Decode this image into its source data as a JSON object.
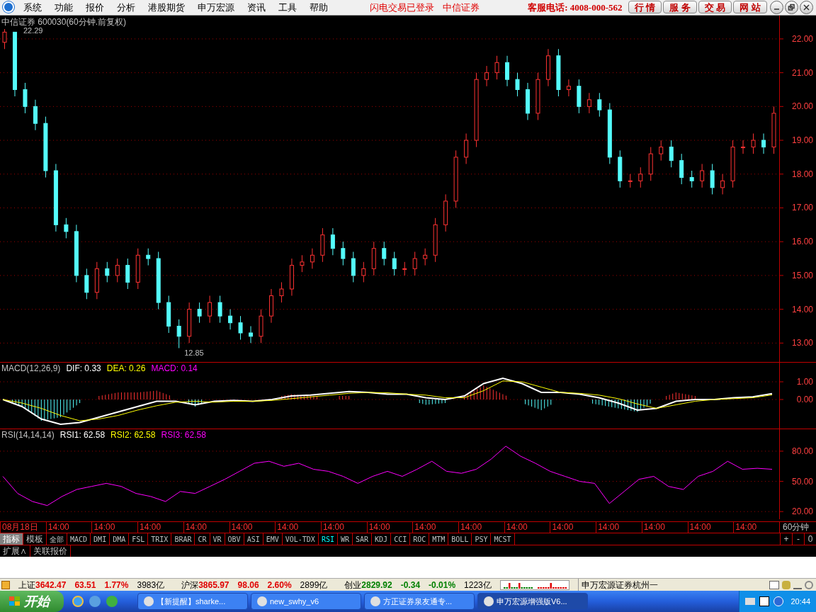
{
  "menu": {
    "items": [
      "系统",
      "功能",
      "报价",
      "分析",
      "港股期货",
      "申万宏源",
      "资讯",
      "工具",
      "帮助"
    ],
    "notices": [
      "闪电交易已登录",
      "中信证券"
    ],
    "hotline": "客服电话: 4008-000-562",
    "buttons": [
      "行 情",
      "服 务",
      "交 易",
      "网 站"
    ]
  },
  "price": {
    "title": "中信证券 600030(60分钟.前复权)",
    "max_label": "22.29",
    "min_label": "12.85",
    "chart_data": {
      "type": "candlestick",
      "ylim": [
        12.42,
        22.69
      ],
      "grid": true,
      "yticks": [
        {
          "value": 22,
          "label": "22.00"
        },
        {
          "value": 21,
          "label": "21.00"
        },
        {
          "value": 20,
          "label": "20.00"
        },
        {
          "value": 19,
          "label": "19.00"
        },
        {
          "value": 18,
          "label": "18.00"
        },
        {
          "value": 17,
          "label": "17.00"
        },
        {
          "value": 16,
          "label": "16.00"
        },
        {
          "value": 15,
          "label": "15.00"
        },
        {
          "value": 14,
          "label": "14.00"
        },
        {
          "value": 13,
          "label": "13.00"
        }
      ],
      "ohlc": [
        [
          21.9,
          22.29,
          21.7,
          22.2
        ],
        [
          22.2,
          22.2,
          20.3,
          20.5
        ],
        [
          20.5,
          20.7,
          19.8,
          20.0
        ],
        [
          20.0,
          20.2,
          19.3,
          19.5
        ],
        [
          19.5,
          19.7,
          17.9,
          18.1
        ],
        [
          18.1,
          18.3,
          16.3,
          16.5
        ],
        [
          16.5,
          16.7,
          16.1,
          16.3
        ],
        [
          16.3,
          16.5,
          14.8,
          15.0
        ],
        [
          15.0,
          15.2,
          14.3,
          14.5
        ],
        [
          14.5,
          15.4,
          14.3,
          15.2
        ],
        [
          15.2,
          15.4,
          14.8,
          15.0
        ],
        [
          15.0,
          15.5,
          14.8,
          15.3
        ],
        [
          15.3,
          15.5,
          14.6,
          14.8
        ],
        [
          14.8,
          15.8,
          14.6,
          15.6
        ],
        [
          15.6,
          15.8,
          15.3,
          15.5
        ],
        [
          15.5,
          15.7,
          14.0,
          14.2
        ],
        [
          14.2,
          14.4,
          13.3,
          13.5
        ],
        [
          13.5,
          13.7,
          12.85,
          13.2
        ],
        [
          13.2,
          14.2,
          13.0,
          14.0
        ],
        [
          14.0,
          14.2,
          13.6,
          13.8
        ],
        [
          13.8,
          14.4,
          13.6,
          14.2
        ],
        [
          14.2,
          14.4,
          13.6,
          13.8
        ],
        [
          13.8,
          14.0,
          13.4,
          13.6
        ],
        [
          13.6,
          13.8,
          13.1,
          13.3
        ],
        [
          13.3,
          13.5,
          13.0,
          13.2
        ],
        [
          13.2,
          14.0,
          13.0,
          13.8
        ],
        [
          13.8,
          14.6,
          13.6,
          14.4
        ],
        [
          14.4,
          14.8,
          14.2,
          14.6
        ],
        [
          14.6,
          15.5,
          14.4,
          15.3
        ],
        [
          15.3,
          15.6,
          15.1,
          15.4
        ],
        [
          15.4,
          15.8,
          15.2,
          15.6
        ],
        [
          15.6,
          16.4,
          15.4,
          16.2
        ],
        [
          16.2,
          16.4,
          15.6,
          15.8
        ],
        [
          15.8,
          16.0,
          15.3,
          15.5
        ],
        [
          15.5,
          15.7,
          14.8,
          15.0
        ],
        [
          15.0,
          15.4,
          14.8,
          15.2
        ],
        [
          15.2,
          16.0,
          15.0,
          15.8
        ],
        [
          15.8,
          16.0,
          15.3,
          15.5
        ],
        [
          15.5,
          15.7,
          15.0,
          15.2
        ],
        [
          15.2,
          15.4,
          15.0,
          15.2
        ],
        [
          15.2,
          15.7,
          15.0,
          15.5
        ],
        [
          15.5,
          15.8,
          15.3,
          15.6
        ],
        [
          15.6,
          16.7,
          15.4,
          16.5
        ],
        [
          16.5,
          17.4,
          16.3,
          17.2
        ],
        [
          17.2,
          18.7,
          17.0,
          18.5
        ],
        [
          18.5,
          19.2,
          18.3,
          19.0
        ],
        [
          19.0,
          21.0,
          18.8,
          20.8
        ],
        [
          20.8,
          21.2,
          20.6,
          21.0
        ],
        [
          21.0,
          21.5,
          20.8,
          21.3
        ],
        [
          21.3,
          21.5,
          20.6,
          20.8
        ],
        [
          20.8,
          21.0,
          20.3,
          20.5
        ],
        [
          20.5,
          20.7,
          19.6,
          19.8
        ],
        [
          19.8,
          21.0,
          19.6,
          20.8
        ],
        [
          20.8,
          21.7,
          20.6,
          21.5
        ],
        [
          21.5,
          21.7,
          20.3,
          20.5
        ],
        [
          20.5,
          20.8,
          20.3,
          20.6
        ],
        [
          20.6,
          20.8,
          19.8,
          20.0
        ],
        [
          20.0,
          20.4,
          19.8,
          20.2
        ],
        [
          20.2,
          20.4,
          19.7,
          19.9
        ],
        [
          19.9,
          20.1,
          18.3,
          18.5
        ],
        [
          18.5,
          18.7,
          17.6,
          17.8
        ],
        [
          17.8,
          18.0,
          17.6,
          17.8
        ],
        [
          17.8,
          18.2,
          17.6,
          18.0
        ],
        [
          18.0,
          18.8,
          17.8,
          18.6
        ],
        [
          18.6,
          19.0,
          18.4,
          18.8
        ],
        [
          18.8,
          19.0,
          18.2,
          18.4
        ],
        [
          18.4,
          18.6,
          17.7,
          17.9
        ],
        [
          17.9,
          18.1,
          17.6,
          17.8
        ],
        [
          17.8,
          18.3,
          17.6,
          18.1
        ],
        [
          18.1,
          18.3,
          17.4,
          17.6
        ],
        [
          17.6,
          18.0,
          17.4,
          17.8
        ],
        [
          17.8,
          19.0,
          17.6,
          18.8
        ],
        [
          18.8,
          19.0,
          18.6,
          18.8
        ],
        [
          18.8,
          19.2,
          18.6,
          19.0
        ],
        [
          19.0,
          19.2,
          18.6,
          18.8
        ],
        [
          18.8,
          20.0,
          18.6,
          19.8
        ]
      ]
    }
  },
  "macd": {
    "label": "MACD(12,26,9)",
    "readings": [
      {
        "text": "DIF: 0.33",
        "color": "#ffffff"
      },
      {
        "text": "DEA: 0.26",
        "color": "#ffff00"
      },
      {
        "text": "MACD: 0.14",
        "color": "#ff00ff"
      }
    ],
    "chart_data": {
      "type": "line",
      "ylim": [
        -1.68,
        2.08
      ],
      "grid": true,
      "yticks": [
        {
          "value": 1,
          "label": "1.00"
        },
        {
          "value": 0,
          "label": "0.00"
        }
      ],
      "series": [
        {
          "color": "#ffffff",
          "values": [
            0.0,
            -0.4,
            -1.1,
            -1.4,
            -1.3,
            -1.0,
            -0.7,
            -0.4,
            -0.1,
            -0.1,
            -0.3,
            -0.1,
            -0.05,
            -0.1,
            0.0,
            0.2,
            0.25,
            0.35,
            0.45,
            0.4,
            0.3,
            0.3,
            0.1,
            0.0,
            0.2,
            0.9,
            1.2,
            0.9,
            0.4,
            0.4,
            0.3,
            0.1,
            -0.2,
            -0.6,
            -0.5,
            -0.1,
            0.0,
            0.0,
            0.1,
            0.15,
            0.33
          ]
        },
        {
          "color": "#ffff00",
          "values": [
            0.0,
            -0.2,
            -0.5,
            -0.9,
            -1.2,
            -1.1,
            -0.9,
            -0.6,
            -0.35,
            -0.15,
            -0.1,
            -0.15,
            -0.1,
            -0.1,
            -0.05,
            0.05,
            0.15,
            0.25,
            0.35,
            0.4,
            0.38,
            0.3,
            0.25,
            0.1,
            0.1,
            0.5,
            1.05,
            1.0,
            0.7,
            0.4,
            0.35,
            0.25,
            0.05,
            -0.25,
            -0.5,
            -0.3,
            -0.1,
            0.0,
            0.05,
            0.1,
            0.26
          ]
        }
      ]
    }
  },
  "rsi": {
    "label": "RSI(14,14,14)",
    "readings": [
      {
        "text": "RSI1: 62.58",
        "color": "#ffffff"
      },
      {
        "text": "RSI2: 62.58",
        "color": "#ffff00"
      },
      {
        "text": "RSI3: 62.58",
        "color": "#ff00ff"
      }
    ],
    "chart_data": {
      "type": "line",
      "ylim": [
        12.4,
        101.8
      ],
      "grid": true,
      "yticks": [
        {
          "value": 80,
          "label": "80.00"
        },
        {
          "value": 50,
          "label": "50.00"
        },
        {
          "value": 20,
          "label": "20.00"
        }
      ],
      "series": [
        {
          "color": "#ff00ff",
          "values": [
            55,
            38,
            30,
            26,
            35,
            42,
            45,
            48,
            45,
            38,
            35,
            30,
            40,
            38,
            45,
            52,
            60,
            68,
            70,
            65,
            68,
            62,
            60,
            55,
            48,
            55,
            60,
            55,
            62,
            70,
            60,
            58,
            62,
            72,
            85,
            75,
            68,
            60,
            55,
            50,
            48,
            28,
            40,
            52,
            55,
            45,
            42,
            55,
            60,
            70,
            62,
            63,
            62
          ]
        }
      ]
    }
  },
  "time_axis": {
    "labels": [
      "08月18日",
      "14:00",
      "14:00",
      "14:00",
      "14:00",
      "14:00",
      "14:00",
      "14:00",
      "14:00",
      "14:00",
      "14:00",
      "14:00",
      "14:00",
      "14:00",
      "14:00",
      "14:00",
      "14:00"
    ],
    "period": "60分钟"
  },
  "indicator_tabs": [
    {
      "label": "指标",
      "selected": true
    },
    {
      "label": "模板",
      "selected": false
    },
    {
      "label": "全部",
      "selected": false
    },
    {
      "label": "MACD",
      "selected": false
    },
    {
      "label": "DMI",
      "selected": false
    },
    {
      "label": "DMA",
      "selected": false
    },
    {
      "label": "FSL",
      "selected": false
    },
    {
      "label": "TRIX",
      "selected": false
    },
    {
      "label": "BRAR",
      "selected": false
    },
    {
      "label": "CR",
      "selected": false
    },
    {
      "label": "VR",
      "selected": false
    },
    {
      "label": "OBV",
      "selected": false
    },
    {
      "label": "ASI",
      "selected": false
    },
    {
      "label": "EMV",
      "selected": false
    },
    {
      "label": "VOL-TDX",
      "selected": false
    },
    {
      "label": "RSI",
      "selected": true
    },
    {
      "label": "WR",
      "selected": false
    },
    {
      "label": "SAR",
      "selected": false
    },
    {
      "label": "KDJ",
      "selected": false
    },
    {
      "label": "CCI",
      "selected": false
    },
    {
      "label": "ROC",
      "selected": false
    },
    {
      "label": "MTM",
      "selected": false
    },
    {
      "label": "BOLL",
      "selected": false
    },
    {
      "label": "PSY",
      "selected": false
    },
    {
      "label": "MCST",
      "selected": false
    }
  ],
  "zoom_buttons": [
    "+",
    "-",
    "0"
  ],
  "sub_tabs": [
    "扩展∧",
    "关联报价"
  ],
  "status": {
    "indices": [
      {
        "name": "上证",
        "value": "3642.47",
        "change": "63.51",
        "percent": "1.77%",
        "volume": "3983亿",
        "kind": "up"
      },
      {
        "name": "沪深",
        "value": "3865.97",
        "change": "98.06",
        "percent": "2.60%",
        "volume": "2899亿",
        "kind": "up"
      },
      {
        "name": "创业",
        "value": "2829.92",
        "change": "-0.34",
        "percent": "-0.01%",
        "volume": "1223亿",
        "kind": "down"
      }
    ],
    "broker": "申万宏源证券杭州一"
  },
  "taskbar": {
    "start": "开始",
    "tasks": [
      {
        "label": "【新提醒】sharke...",
        "selected": false
      },
      {
        "label": "new_swhy_v6",
        "selected": false
      },
      {
        "label": "方正证券泉友通专...",
        "selected": false
      },
      {
        "label": "申万宏源增强版V6...",
        "selected": true
      }
    ],
    "clock": "20:44"
  }
}
